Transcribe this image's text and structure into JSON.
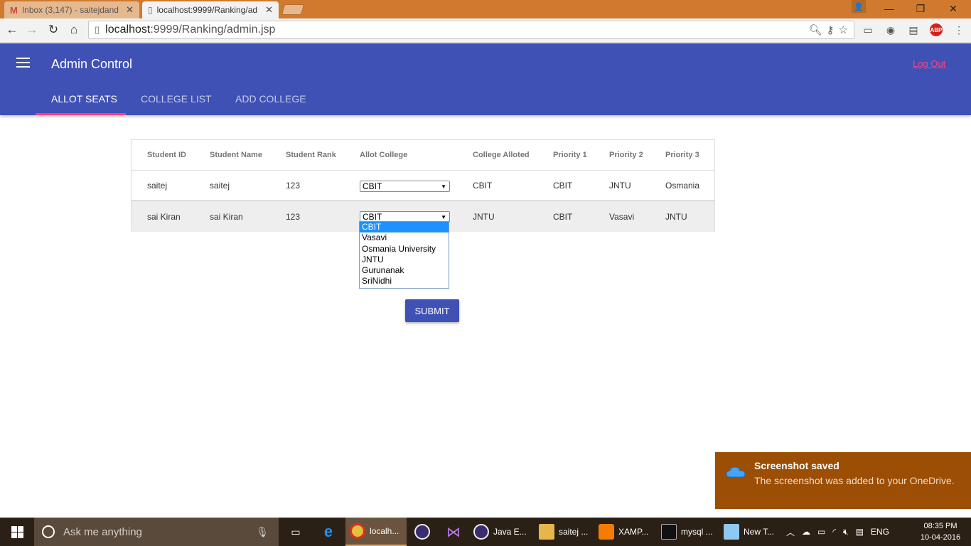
{
  "browser": {
    "tabs": [
      {
        "title": "Inbox (3,147) - saitejdand",
        "active": false
      },
      {
        "title": "localhost:9999/Ranking/ad",
        "active": true
      }
    ],
    "url_host": "localhost",
    "url_rest": ":9999/Ranking/admin.jsp"
  },
  "header": {
    "title": "Admin Control",
    "logout_label": "Log Out",
    "tabs": [
      "ALLOT SEATS",
      "COLLEGE LIST",
      "ADD COLLEGE"
    ]
  },
  "table": {
    "columns": [
      "Student ID",
      "Student Name",
      "Student Rank",
      "Allot College",
      "College Alloted",
      "Priority 1",
      "Priority 2",
      "Priority 3"
    ],
    "rows": [
      {
        "id": "saitej",
        "name": "saitej",
        "rank": "123",
        "allot": "CBIT",
        "alloted": "CBIT",
        "p1": "CBIT",
        "p2": "JNTU",
        "p3": "Osmania"
      },
      {
        "id": "sai Kiran",
        "name": "sai Kiran",
        "rank": "123",
        "allot": "CBIT",
        "alloted": "JNTU",
        "p1": "CBIT",
        "p2": "Vasavi",
        "p3": "JNTU"
      }
    ]
  },
  "dropdown": {
    "options": [
      "CBIT",
      "Vasavi",
      "Osmania University",
      "JNTU",
      "Gurunanak",
      "SriNidhi"
    ],
    "selected": "CBIT"
  },
  "submit_label": "SUBMIT",
  "toast": {
    "title": "Screenshot saved",
    "body": "The screenshot was added to your OneDrive."
  },
  "taskbar": {
    "search_placeholder": "Ask me anything",
    "apps": [
      "localh...",
      "Java E...",
      "saitej ...",
      "XAMP...",
      "mysql ...",
      "New T..."
    ],
    "language": "ENG",
    "time": "08:35 PM",
    "date": "10-04-2016"
  },
  "colors": {
    "primary": "#3f51b5",
    "accent": "#ff4081",
    "tab_bar": "#cf7a2e",
    "toast": "#9b4e04"
  }
}
